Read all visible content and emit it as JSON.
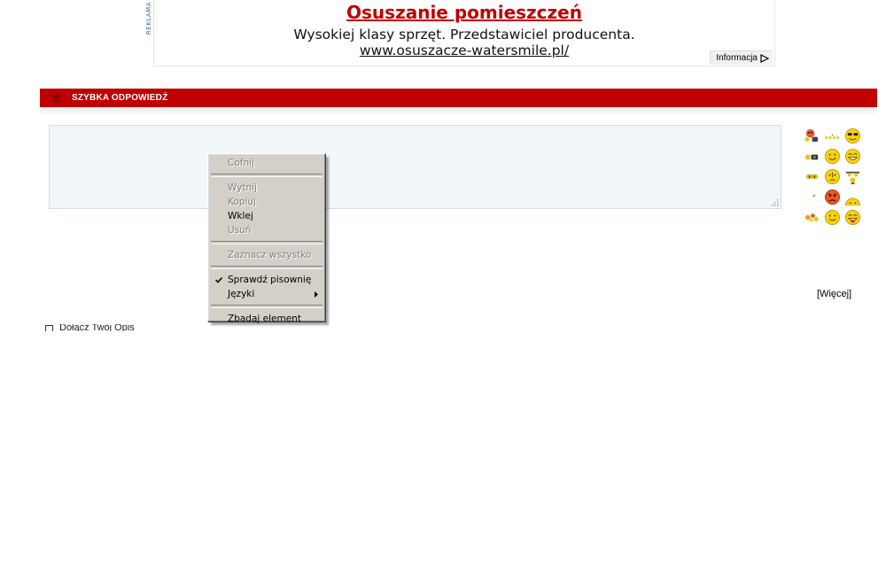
{
  "ad": {
    "side_label": "REKLAMA",
    "title": "Osuszanie pomieszczeń",
    "description": "Wysokiej klasy sprzęt. Przedstawiciel producenta.",
    "url": "www.osuszacze-watersmile.pl/",
    "info_label": "Informacja",
    "title_color": "#c00000"
  },
  "section": {
    "title": "SZYBKA ODPOWIEDŹ",
    "bar_color": "#c00000",
    "icon": "reply-arrows-icon"
  },
  "reply": {
    "value": "",
    "background": "#f3f6f9"
  },
  "smilies": {
    "more_label": "[Więcej]",
    "items": [
      "devil-smiley-icon",
      "dots-smiley-icon",
      "cool-smiley-icon",
      "tiny-smiley-icon",
      "smile-icon",
      "grin-icon",
      "eyes-smiley-icon",
      "neutral-smiley-icon",
      "dance-smiley-icon",
      "wink-dot-icon",
      "angry-smiley-icon",
      "sad-smiley-icon",
      "flower-smiley-icon",
      "happy-smiley-icon",
      "tongue-smiley-icon"
    ]
  },
  "options": {
    "checkbox_label": "Dołącz Twój Opis"
  },
  "context_menu": {
    "items": [
      {
        "label": "Cofnij",
        "enabled": false
      },
      {
        "label": "Wytnij",
        "enabled": false
      },
      {
        "label": "Kopiuj",
        "enabled": false
      },
      {
        "label": "Wklej",
        "enabled": true
      },
      {
        "label": "Usuń",
        "enabled": false
      },
      {
        "label": "Zaznacz wszystko",
        "enabled": false
      },
      {
        "label": "Sprawdź pisownię",
        "enabled": true,
        "checked": true
      },
      {
        "label": "Języki",
        "enabled": true,
        "submenu": true
      },
      {
        "label": "Zbadaj element",
        "enabled": true
      }
    ]
  }
}
